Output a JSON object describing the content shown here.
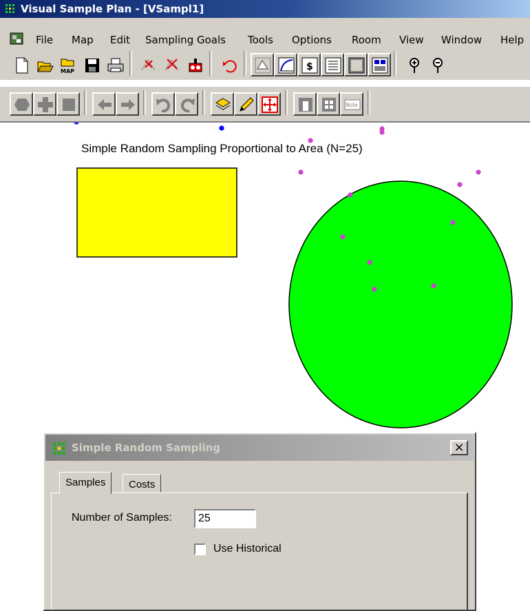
{
  "window": {
    "title": "Visual Sample Plan - [VSampl1]"
  },
  "menu": [
    "File",
    "Map",
    "Edit",
    "Sampling Goals",
    "Tools",
    "Options",
    "Room",
    "View",
    "Window",
    "Help"
  ],
  "toolbar1_icons": [
    "new-file-icon",
    "open-file-icon",
    "open-map-icon",
    "save-icon",
    "print-icon",
    "add-sample-icon",
    "remove-sample-icon",
    "robot-icon",
    "undo-icon",
    "map-view-icon",
    "graph-view-icon",
    "cost-view-icon",
    "report-view-icon",
    "data-view-icon",
    "coordinates-view-icon",
    "pin-icon",
    "pin-outline-icon"
  ],
  "toolbar2_icons": [
    "polygon-draw-icon",
    "plus-draw-icon",
    "square-draw-icon",
    "arrow-left-icon",
    "arrow-right-icon",
    "curve-left-icon",
    "curve-right-icon",
    "layers-icon",
    "pencil-icon",
    "move-icon",
    "grid-single-icon",
    "grid-multi-icon"
  ],
  "toolbar2_note_label": "Note",
  "canvas": {
    "title": "Simple Random Sampling Proportional to Area (N=25)",
    "colors": {
      "rectangle": "#ffff00",
      "ellipse": "#00ff00",
      "rect_points": "#0000ff",
      "ellipse_points": "#cc44cc"
    }
  },
  "dialog": {
    "title": "Simple Random Sampling",
    "close_label": "×",
    "tabs": [
      "Samples",
      "Costs"
    ],
    "active_tab": "Samples",
    "num_samples_label": "Number of Samples:",
    "num_samples_value": "25",
    "use_historical_label": "Use Historical",
    "use_historical_checked": false
  }
}
